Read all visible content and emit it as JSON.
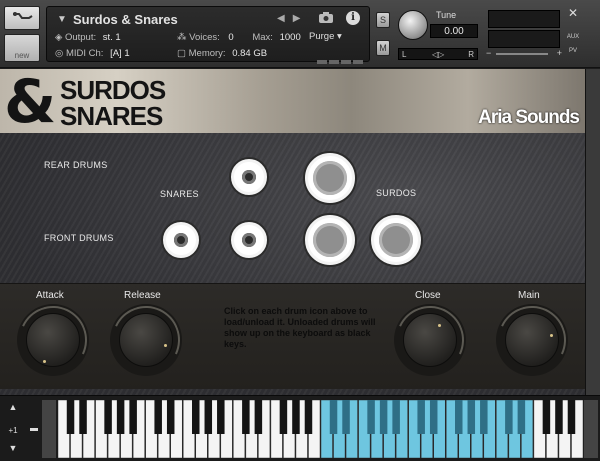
{
  "header": {
    "instrument_name": "Surdos & Snares",
    "output_label": "Output:",
    "output_value": "st. 1",
    "voices_label": "Voices:",
    "voices_value": "0",
    "max_label": "Max:",
    "max_value": "1000",
    "purge_label": "Purge",
    "midi_label": "MIDI Ch:",
    "midi_value": "[A]  1",
    "memory_label": "Memory:",
    "memory_value": "0.84 GB",
    "new_label": "new",
    "s_button": "S",
    "m_button": "M",
    "tune_label": "Tune",
    "tune_value": "0.00",
    "pan_left": "L",
    "pan_right": "R",
    "aux_label": "AUX",
    "pv_label": "PV",
    "minus_label": "−",
    "plus_label": "+",
    "close_label": "✕"
  },
  "banner": {
    "brand_amp": "&",
    "brand_line1": "SURDOS",
    "brand_line2": "SNARES",
    "company": "Aria Sounds"
  },
  "drums": {
    "rear_label": "REAR DRUMS",
    "front_label": "FRONT DRUMS",
    "snares_label": "SNARES",
    "surdos_label": "SURDOS"
  },
  "controls": {
    "attack_label": "Attack",
    "release_label": "Release",
    "close_label": "Close",
    "main_label": "Main",
    "hint_text": "Click on each drum icon above to load/unload it. Unloaded drums will show up on the keyboard as black keys."
  },
  "keyboard": {
    "octave_value": "+1"
  },
  "colors": {
    "key_highlight": "#6ec6e0",
    "panel_dark": "#2d2b28"
  }
}
